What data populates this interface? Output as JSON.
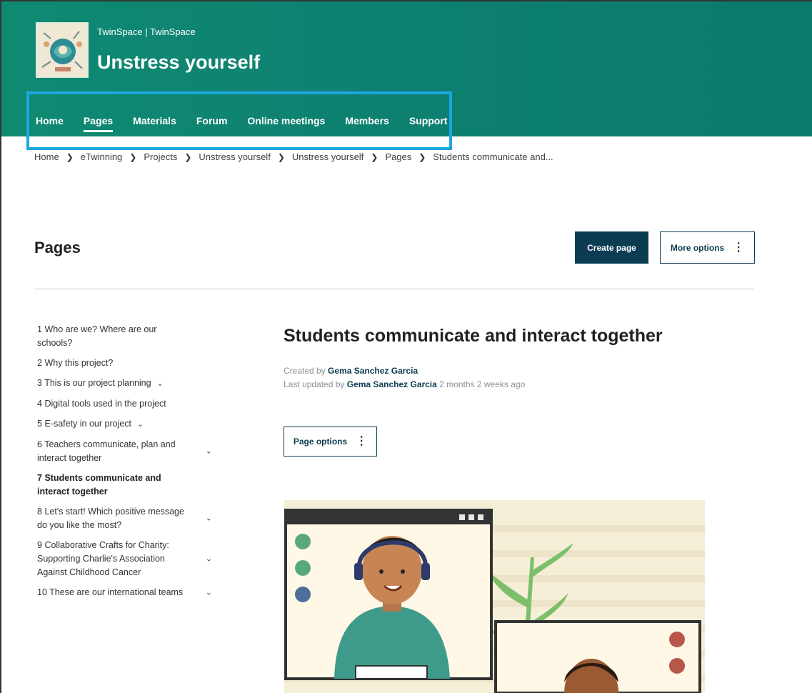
{
  "header": {
    "site_subtitle": "TwinSpace | TwinSpace",
    "site_title": "Unstress yourself",
    "nav": [
      "Home",
      "Pages",
      "Materials",
      "Forum",
      "Online meetings",
      "Members",
      "Support"
    ],
    "active_nav": "Pages"
  },
  "breadcrumb": [
    "Home",
    "eTwinning",
    "Projects",
    "Unstress yourself",
    "Unstress yourself",
    "Pages",
    "Students communicate and..."
  ],
  "pages": {
    "title": "Pages",
    "create_label": "Create page",
    "more_label": "More options"
  },
  "sidebar": {
    "items": [
      {
        "num": "1",
        "text": "Who are we? Where are our schools?"
      },
      {
        "num": "2",
        "text": "Why this project?"
      },
      {
        "num": "3",
        "text": "This is our project planning"
      },
      {
        "num": "4",
        "text": "Digital tools used in the project"
      },
      {
        "num": "5",
        "text": "E-safety in our project"
      },
      {
        "num": "6",
        "text": "Teachers communicate, plan and interact together"
      },
      {
        "num": "7",
        "text": "Students communicate and interact together"
      },
      {
        "num": "8",
        "text": "Let's start! Which positive message do you like the most?"
      },
      {
        "num": "9",
        "text": "Collaborative Crafts for Charity: Supporting Charlie's Association Against Childhood Cancer"
      },
      {
        "num": "10",
        "text": "These are our international teams"
      }
    ]
  },
  "main": {
    "title": "Students communicate and interact together",
    "created_prefix": "Created by",
    "created_by": "Gema Sanchez Garcia",
    "updated_prefix": "Last updated by",
    "updated_by": "Gema Sanchez Garcia",
    "updated_ago": "2 months 2 weeks ago",
    "page_options_label": "Page options"
  },
  "colors": {
    "header_bg": "#0f8a72",
    "primary": "#0b3c52",
    "highlight": "#1ea6e0"
  }
}
